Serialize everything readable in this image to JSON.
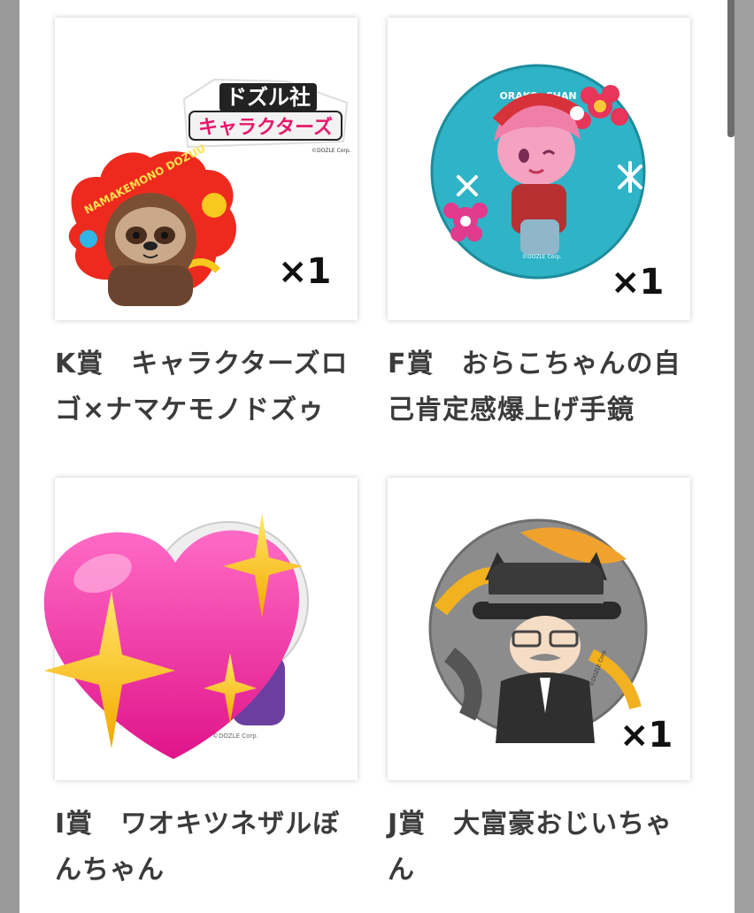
{
  "prizes": [
    {
      "name": "K賞　キャラクターズロゴ×ナマケモノドズゥ",
      "quantity": "×1",
      "logo_line1": "ドズル社",
      "logo_line2": "キャラクターズ",
      "sticker_text": "NAMAKEMONO DOZUU",
      "copyright": "©DOZLE Corp."
    },
    {
      "name": "F賞　おらこちゃんの自己肯定感爆上げ手鏡",
      "quantity": "×1",
      "badge_text": "ORAKO -CHAN",
      "copyright": "©DOZLE Corp."
    },
    {
      "name": "I賞　ワオキツネザルぼんちゃん",
      "quantity": "",
      "copyright": "©DOZLE Corp."
    },
    {
      "name": "J賞　大富豪おじいちゃん",
      "quantity": "×1",
      "copyright": "©DOZLE Corp."
    }
  ],
  "overlay_emoji": "sparkling-heart",
  "colors": {
    "page_bg": "#ffffff",
    "backdrop": "#9a9a9a",
    "text": "#3b3b3b"
  }
}
